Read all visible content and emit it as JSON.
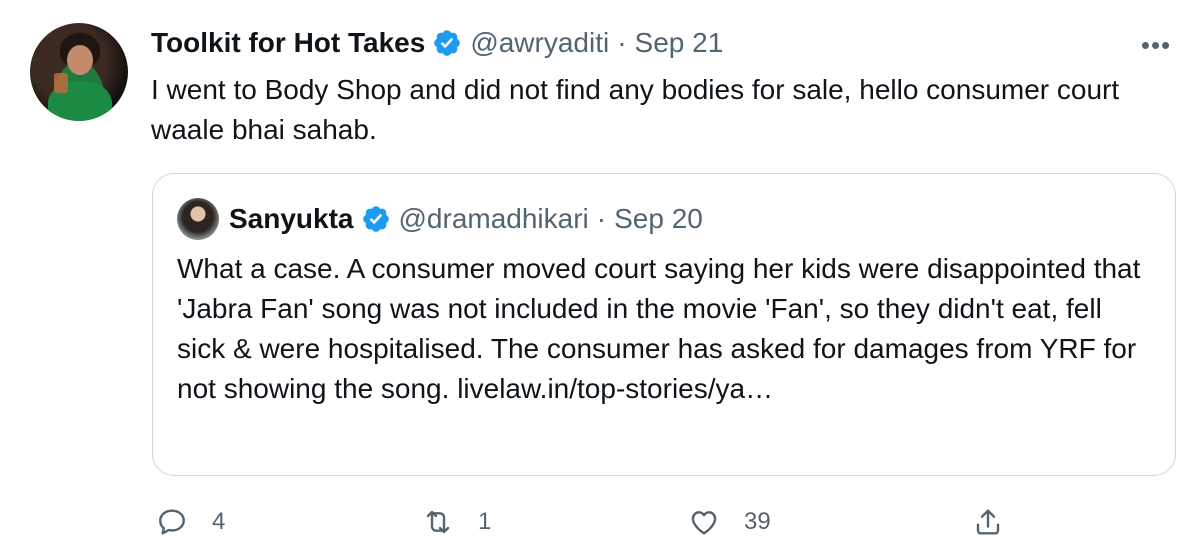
{
  "tweet": {
    "display_name": "Toolkit for Hot Takes",
    "handle": "@awryaditi",
    "separator": "·",
    "date": "Sep 21",
    "more_label": "•••",
    "text": "I went to Body Shop and did not find any bodies for sale, hello consumer court waale bhai sahab."
  },
  "quote": {
    "display_name": "Sanyukta",
    "handle": "@dramadhikari",
    "separator": "·",
    "date": "Sep 20",
    "text": "What a case. A consumer moved court saying her kids were disappointed that 'Jabra Fan' song was not included in the movie 'Fan', so they didn't eat, fell sick & were hospitalised. The consumer has asked for damages from YRF for not showing the song.  livelaw.in/top-stories/ya…"
  },
  "actions": {
    "reply_count": "4",
    "retweet_count": "1",
    "like_count": "39"
  },
  "colors": {
    "verified": "#1d9bf0",
    "muted": "#536471",
    "border": "#cfd9de",
    "text": "#0f1419"
  },
  "icons": [
    "verified-badge-icon",
    "more-icon",
    "reply-icon",
    "retweet-icon",
    "like-icon",
    "share-icon"
  ]
}
